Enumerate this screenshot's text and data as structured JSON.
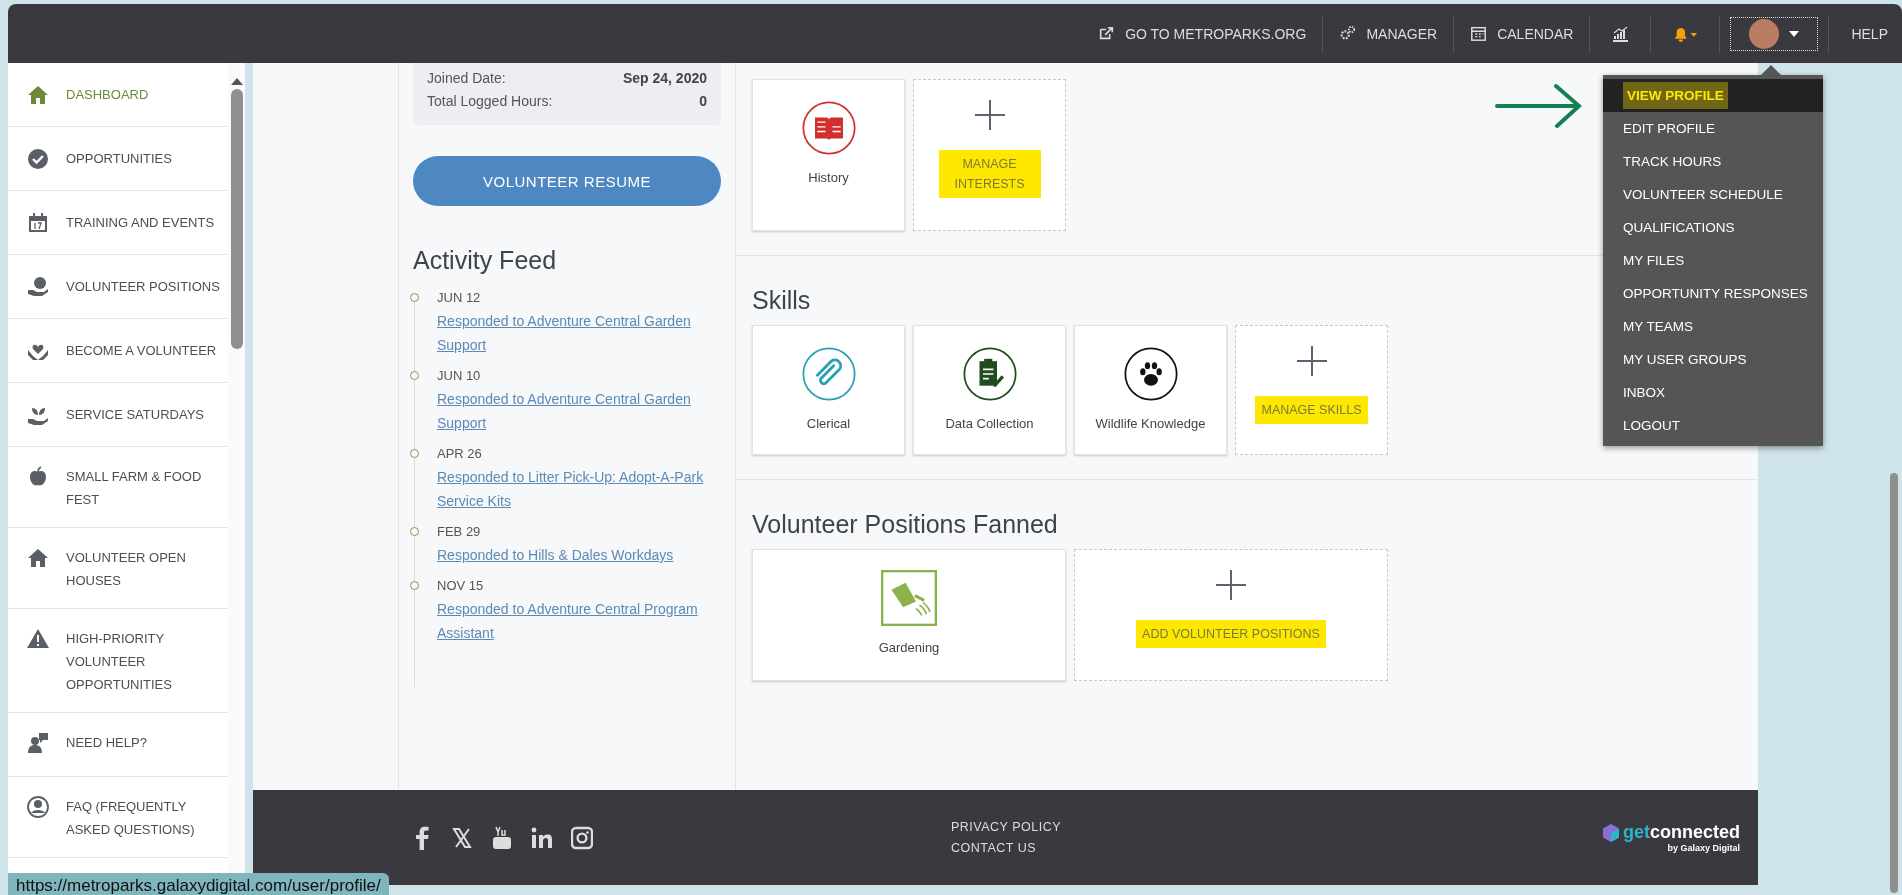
{
  "top_nav": {
    "links": [
      {
        "label": "GO TO METROPARKS.ORG"
      },
      {
        "label": "MANAGER"
      },
      {
        "label": "CALENDAR"
      }
    ],
    "help": "HELP"
  },
  "sidebar": {
    "items": [
      {
        "label": "DASHBOARD",
        "selected": true
      },
      {
        "label": "OPPORTUNITIES",
        "selected": false
      },
      {
        "label": "TRAINING AND EVENTS",
        "selected": false
      },
      {
        "label": "VOLUNTEER POSITIONS",
        "selected": false
      },
      {
        "label": "BECOME A VOLUNTEER",
        "selected": false
      },
      {
        "label": "SERVICE SATURDAYS",
        "selected": false
      },
      {
        "label": "SMALL FARM & FOOD FEST",
        "selected": false
      },
      {
        "label": "VOLUNTEER OPEN HOUSES",
        "selected": false
      },
      {
        "label": "HIGH-PRIORITY VOLUNTEER OPPORTUNITIES",
        "selected": false
      },
      {
        "label": "NEED HELP?",
        "selected": false
      },
      {
        "label": "FAQ (FREQUENTLY ASKED QUESTIONS)",
        "selected": false
      }
    ]
  },
  "profile_summary": {
    "rows": [
      {
        "label": "Joined Date:",
        "value": "Sep 24, 2020"
      },
      {
        "label": "Total Logged Hours:",
        "value": "0"
      }
    ]
  },
  "resume_button": "VOLUNTEER RESUME",
  "activity_feed": {
    "title": "Activity Feed",
    "entries": [
      {
        "date": "JUN 12",
        "text": "Responded to Adventure Central Garden Support"
      },
      {
        "date": "JUN 10",
        "text": "Responded to Adventure Central Garden Support"
      },
      {
        "date": "APR 26",
        "text": "Responded to Litter Pick-Up: Adopt-A-Park Service Kits"
      },
      {
        "date": "FEB 29",
        "text": "Responded to Hills & Dales Workdays"
      },
      {
        "date": "NOV 15",
        "text": "Responded to Adventure Central Program Assistant"
      }
    ]
  },
  "sections": [
    {
      "cards": [
        {
          "kind": "item",
          "label": "History",
          "color": "#d32f2f"
        },
        {
          "kind": "add",
          "label": "MANAGE INTERESTS",
          "highlighted": true
        }
      ]
    },
    {
      "title": "Skills",
      "cards": [
        {
          "kind": "item",
          "label": "Clerical",
          "color": "#2aa1b3"
        },
        {
          "kind": "item",
          "label": "Data Collection",
          "color": "#1f4d1f"
        },
        {
          "kind": "item",
          "label": "Wildlife Knowledge",
          "color": "#111111"
        },
        {
          "kind": "add",
          "label": "MANAGE SKILLS",
          "highlighted": true
        }
      ]
    },
    {
      "title": "Volunteer Positions Fanned",
      "cards": [
        {
          "kind": "item",
          "label": "Gardening",
          "color": "#8cb24a"
        },
        {
          "kind": "add",
          "label": "ADD VOLUNTEER POSITIONS",
          "highlighted": true
        }
      ]
    }
  ],
  "profile_menu": {
    "items": [
      {
        "label": "VIEW PROFILE",
        "selected": true,
        "highlighted": true
      },
      {
        "label": "EDIT PROFILE",
        "selected": false,
        "highlighted": false
      },
      {
        "label": "TRACK HOURS",
        "selected": false,
        "highlighted": false
      },
      {
        "label": "VOLUNTEER SCHEDULE",
        "selected": false,
        "highlighted": false
      },
      {
        "label": "QUALIFICATIONS",
        "selected": false,
        "highlighted": false
      },
      {
        "label": "MY FILES",
        "selected": false,
        "highlighted": false
      },
      {
        "label": "OPPORTUNITY RESPONSES",
        "selected": false,
        "highlighted": false
      },
      {
        "label": "MY TEAMS",
        "selected": false,
        "highlighted": false
      },
      {
        "label": "MY USER GROUPS",
        "selected": false,
        "highlighted": false
      },
      {
        "label": "INBOX",
        "selected": false,
        "highlighted": false
      },
      {
        "label": "LOGOUT",
        "selected": false,
        "highlighted": false
      }
    ]
  },
  "footer": {
    "links": [
      "PRIVACY POLICY",
      "CONTACT US"
    ],
    "logo_word_1": "get",
    "logo_word_2": "connected",
    "logo_tagline": "by Galaxy Digital"
  },
  "status_url": "https://metroparks.galaxydigital.com/user/profile/"
}
